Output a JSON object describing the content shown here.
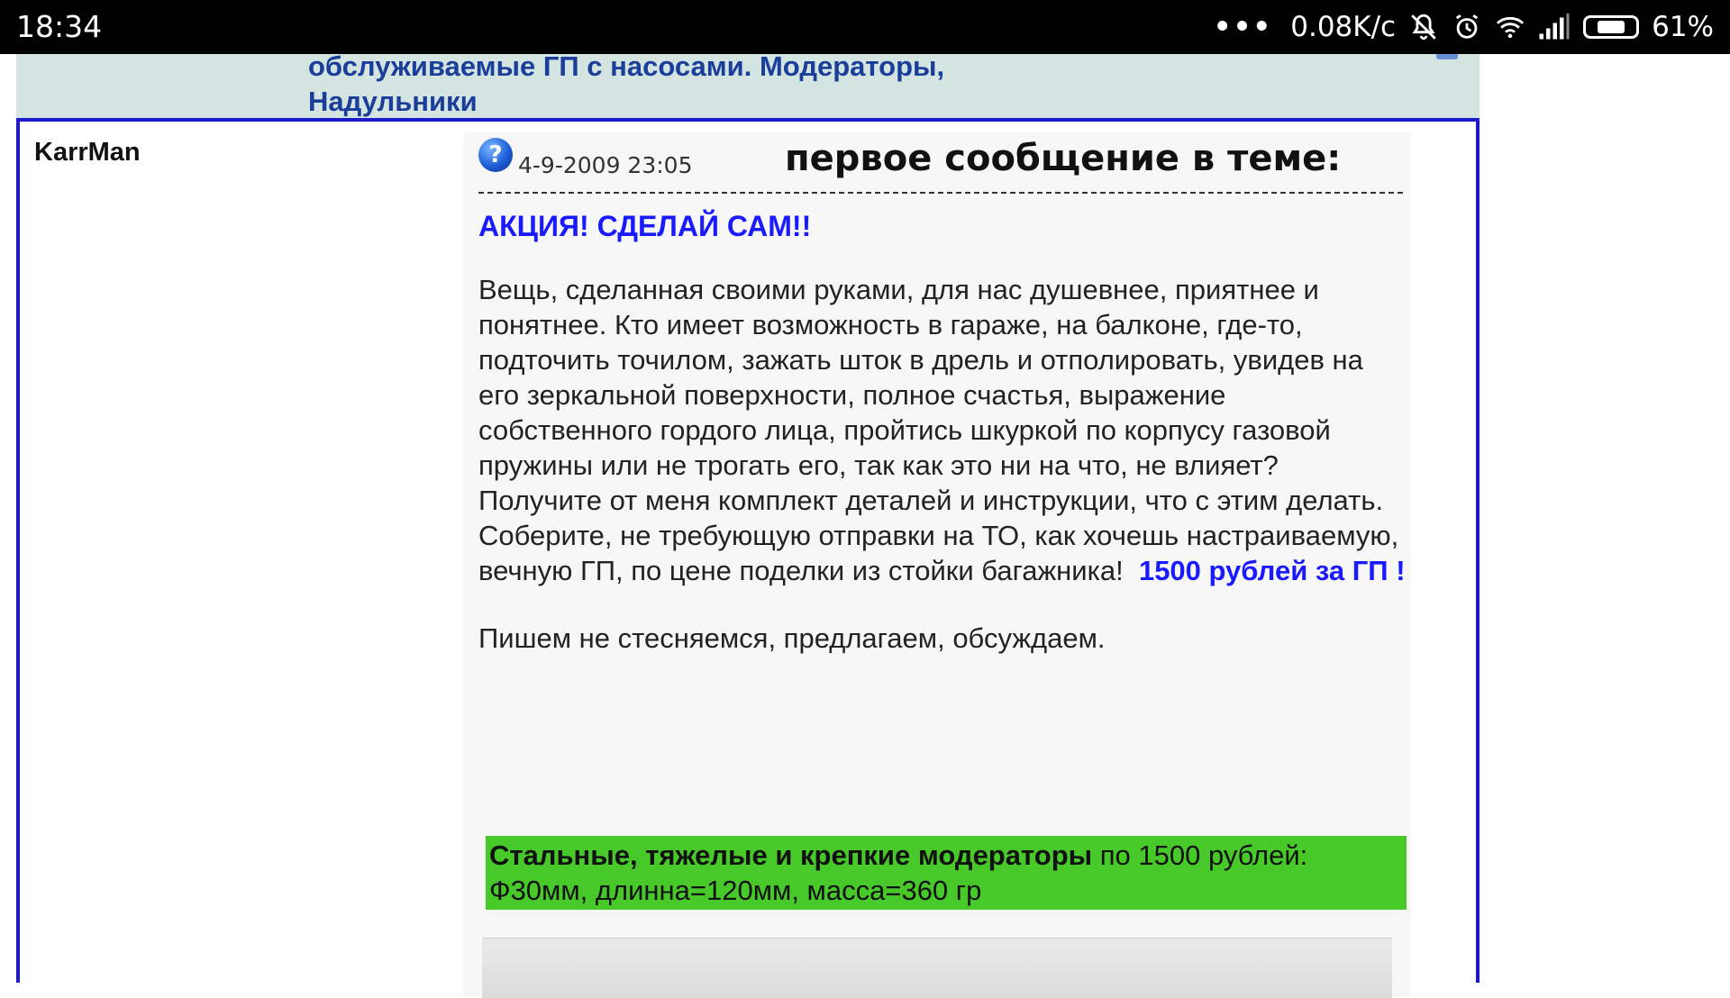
{
  "status_bar": {
    "time": "18:34",
    "dots": "•••",
    "net_speed": "0.08K/c",
    "battery_percent": "61%",
    "battery_level": 0.61,
    "icons": [
      "notifications-off-icon",
      "alarm-icon",
      "wifi-icon",
      "signal-icon",
      "battery-icon"
    ]
  },
  "topic": {
    "title": "обслуживаемые ГП с насосами. Модераторы,\nНадульники"
  },
  "post": {
    "author": "KarrMan",
    "icon": "question-icon",
    "date": "4-9-2009 23:05",
    "first_message_label": "первое сообщение в теме:",
    "headline": "АКЦИЯ! СДЕЛАЙ САМ!!",
    "paragraph1": "Вещь, сделанная своими руками, для нас душевнее, приятнее и понятнее. Кто имеет возможность в гараже, на балконе, где-то, подточить точилом, зажать шток в дрель и отполировать, увидев на его зеркальной поверхности, полное счастья, выражение собственного гордого лица, пройтись шкуркой по корпусу газовой пружины или не трогать его, так как это ни на что, не влияет?",
    "paragraph2": "Получите от меня комплект деталей и инструкции, что с этим делать. Соберите, не требующую отправки на ТО, как хочешь настраиваемую, вечную ГП, по цене поделки из стойки багажника!",
    "price_highlight": "1500 рублей за ГП !",
    "paragraph3": "Пишем не стесняемся, предлагаем, обсуждаем.",
    "green_bold": "Стальные, тяжелые и крепкие модераторы",
    "green_rest": " по 1500 рублей: Ф30мм, длинна=120мм, масса=360 гр"
  },
  "colors": {
    "status_bg": "#000000",
    "band_bg": "#d4e5e1",
    "topic_text": "#1a3e99",
    "frame_border": "#1b1bcc",
    "highlight_blue": "#1a1aff",
    "green_box": "#48c92a"
  }
}
